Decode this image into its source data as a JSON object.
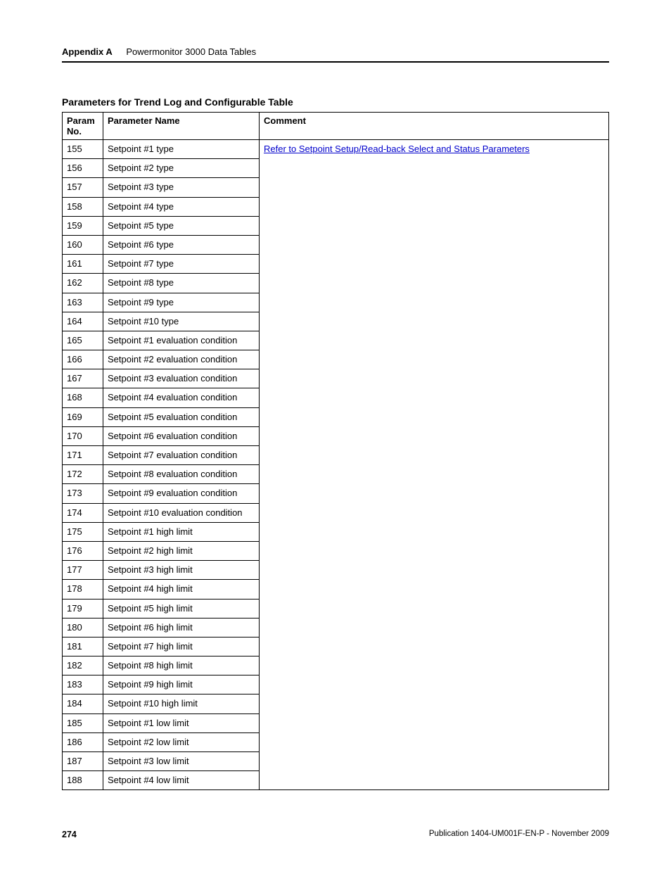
{
  "header": {
    "appendix": "Appendix A",
    "chapter": "Powermonitor 3000 Data Tables"
  },
  "table": {
    "title": "Parameters for Trend Log and Configurable Table",
    "columns": {
      "no": "Param No.",
      "name": "Parameter Name",
      "comment": "Comment"
    },
    "comment_link": "Refer to  Setpoint Setup/Read-back Select and Status Parameters ",
    "rows": [
      {
        "no": "155",
        "name": "Setpoint #1 type"
      },
      {
        "no": "156",
        "name": "Setpoint #2 type"
      },
      {
        "no": "157",
        "name": "Setpoint #3 type"
      },
      {
        "no": "158",
        "name": "Setpoint #4 type"
      },
      {
        "no": "159",
        "name": "Setpoint #5 type"
      },
      {
        "no": "160",
        "name": "Setpoint #6 type"
      },
      {
        "no": "161",
        "name": "Setpoint #7 type"
      },
      {
        "no": "162",
        "name": "Setpoint #8 type"
      },
      {
        "no": "163",
        "name": "Setpoint #9 type"
      },
      {
        "no": "164",
        "name": "Setpoint #10 type"
      },
      {
        "no": "165",
        "name": "Setpoint #1 evaluation condition"
      },
      {
        "no": "166",
        "name": "Setpoint #2 evaluation condition"
      },
      {
        "no": "167",
        "name": "Setpoint #3 evaluation condition"
      },
      {
        "no": "168",
        "name": "Setpoint #4 evaluation condition"
      },
      {
        "no": "169",
        "name": "Setpoint #5 evaluation condition"
      },
      {
        "no": "170",
        "name": "Setpoint #6 evaluation condition"
      },
      {
        "no": "171",
        "name": "Setpoint #7 evaluation condition"
      },
      {
        "no": "172",
        "name": "Setpoint #8 evaluation condition"
      },
      {
        "no": "173",
        "name": "Setpoint #9 evaluation condition"
      },
      {
        "no": "174",
        "name": "Setpoint #10 evaluation condition"
      },
      {
        "no": "175",
        "name": "Setpoint #1 high limit"
      },
      {
        "no": "176",
        "name": "Setpoint #2 high limit"
      },
      {
        "no": "177",
        "name": "Setpoint #3 high limit"
      },
      {
        "no": "178",
        "name": "Setpoint #4 high limit"
      },
      {
        "no": "179",
        "name": "Setpoint #5 high limit"
      },
      {
        "no": "180",
        "name": "Setpoint #6 high limit"
      },
      {
        "no": "181",
        "name": "Setpoint #7 high limit"
      },
      {
        "no": "182",
        "name": "Setpoint #8 high limit"
      },
      {
        "no": "183",
        "name": "Setpoint #9 high limit"
      },
      {
        "no": "184",
        "name": "Setpoint #10 high limit"
      },
      {
        "no": "185",
        "name": "Setpoint #1 low limit"
      },
      {
        "no": "186",
        "name": "Setpoint #2 low limit"
      },
      {
        "no": "187",
        "name": "Setpoint #3 low limit"
      },
      {
        "no": "188",
        "name": "Setpoint #4 low limit"
      }
    ]
  },
  "footer": {
    "page_number": "274",
    "publication": "Publication 1404-UM001F-EN-P - November 2009"
  }
}
